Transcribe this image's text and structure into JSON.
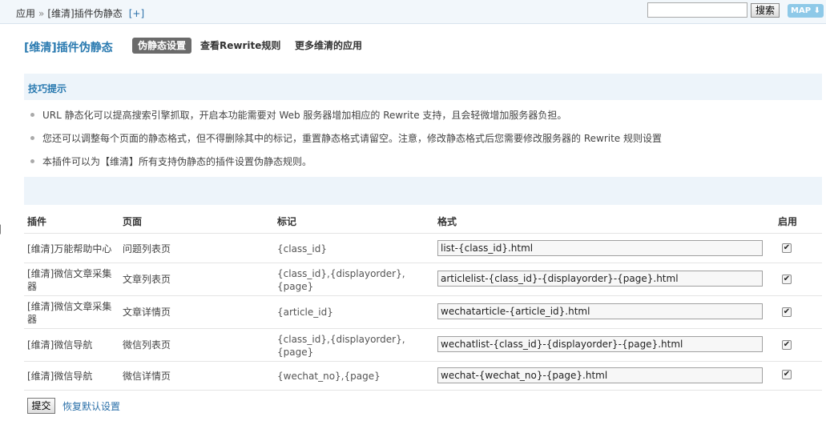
{
  "breadcrumb": {
    "root": "应用",
    "separator": "»",
    "current": "[维清]插件伪静态",
    "add": "[+]"
  },
  "search": {
    "value": "",
    "button": "搜索"
  },
  "map_button": "MAP",
  "header": {
    "title": "[维清]插件伪静态",
    "tabs": [
      {
        "label": "伪静态设置",
        "active": true
      },
      {
        "label": "查看Rewrite规则",
        "active": false
      },
      {
        "label": "更多维清的应用",
        "active": false
      }
    ]
  },
  "tips": {
    "title": "技巧提示",
    "items": [
      "URL 静态化可以提高搜索引擎抓取，开启本功能需要对 Web 服务器增加相应的 Rewrite 支持，且会轻微增加服务器负担。",
      "您还可以调整每个页面的静态格式，但不得删除其中的标记，重置静态格式请留空。注意，修改静态格式后您需要修改服务器的 Rewrite 规则设置",
      "本插件可以为【维清】所有支持伪静态的插件设置伪静态规则。"
    ]
  },
  "table": {
    "headers": {
      "plugin": "插件",
      "page": "页面",
      "mark": "标记",
      "format": "格式",
      "enable": "启用"
    },
    "rows": [
      {
        "plugin": "[维清]万能帮助中心",
        "page": "问题列表页",
        "mark": "{class_id}",
        "format": "list-{class_id}.html",
        "enabled": true
      },
      {
        "plugin": "[维清]微信文章采集器",
        "page": "文章列表页",
        "mark": "{class_id},{displayorder},{page}",
        "format": "articlelist-{class_id}-{displayorder}-{page}.html",
        "enabled": true
      },
      {
        "plugin": "[维清]微信文章采集器",
        "page": "文章详情页",
        "mark": "{article_id}",
        "format": "wechatarticle-{article_id}.html",
        "enabled": true
      },
      {
        "plugin": "[维清]微信导航",
        "page": "微信列表页",
        "mark": "{class_id},{displayorder},{page}",
        "format": "wechatlist-{class_id}-{displayorder}-{page}.html",
        "enabled": true
      },
      {
        "plugin": "[维清]微信导航",
        "page": "微信详情页",
        "mark": "{wechat_no},{page}",
        "format": "wechat-{wechat_no}-{page}.html",
        "enabled": true
      }
    ]
  },
  "actions": {
    "submit": "提交",
    "reset": "恢复默认设置"
  }
}
